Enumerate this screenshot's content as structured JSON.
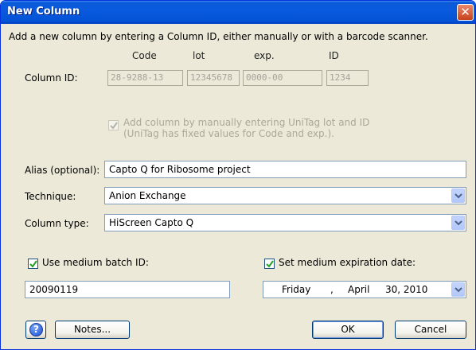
{
  "window": {
    "title": "New Column"
  },
  "intro": "Add a new column by entering a Column ID, either manually or with a barcode scanner.",
  "column_id": {
    "label": "Column ID:",
    "headers": [
      "Code",
      "lot",
      "exp.",
      "ID"
    ],
    "values": [
      "28-9288-13",
      "12345678",
      "0000-00",
      "1234"
    ],
    "unitag_checkbox": {
      "checked": true,
      "enabled": false,
      "line1": "Add column by manually entering UniTag lot and ID",
      "line2": "(UniTag has fixed values for Code and exp.)."
    }
  },
  "alias": {
    "label": "Alias (optional):",
    "value": "Capto Q for Ribosome project"
  },
  "technique": {
    "label": "Technique:",
    "value": "Anion Exchange"
  },
  "column_type": {
    "label": "Column type:",
    "value": "HiScreen Capto Q"
  },
  "batch": {
    "label": "Use medium batch ID:",
    "checked": true,
    "value": "20090119"
  },
  "expiration": {
    "label": "Set medium expiration date:",
    "checked": true,
    "weekday": "Friday",
    "sep": ",",
    "month": "April",
    "day_year": "30, 2010"
  },
  "buttons": {
    "help": "?",
    "notes": "Notes...",
    "ok": "OK",
    "cancel": "Cancel"
  },
  "icons": {
    "close": "close-icon",
    "help": "help-icon",
    "dropdown": "chevron-down-icon",
    "check": "checkmark-icon"
  },
  "colors": {
    "titlebar": "#0a5adf",
    "close_button": "#d7542b",
    "dialog_bg": "#ece9d8",
    "checkmark": "#21a121",
    "field_border": "#7f9db9"
  }
}
